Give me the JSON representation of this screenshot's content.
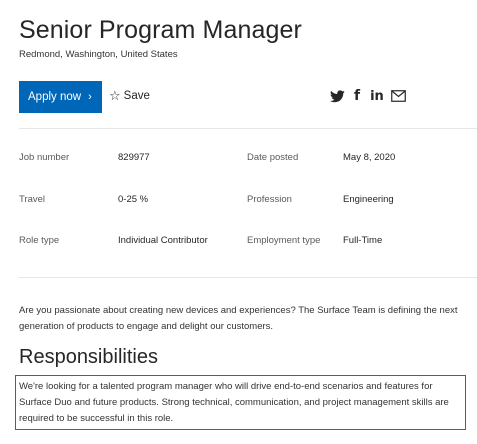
{
  "job": {
    "title": "Senior Program Manager",
    "location": "Redmond, Washington, United States"
  },
  "actions": {
    "apply_label": "Apply now",
    "apply_chevron": "›",
    "save_label": "Save",
    "save_icon_glyph": "☆"
  },
  "share": {
    "icons": [
      "twitter-icon",
      "facebook-icon",
      "linkedin-icon",
      "email-icon"
    ],
    "facebook_glyph": "f",
    "linkedin_glyph": "in"
  },
  "details": {
    "job_number_label": "Job number",
    "job_number_value": "829977",
    "date_posted_label": "Date posted",
    "date_posted_value": "May 8, 2020",
    "travel_label": "Travel",
    "travel_value": "0-25 %",
    "profession_label": "Profession",
    "profession_value": "Engineering",
    "role_type_label": "Role type",
    "role_type_value": "Individual Contributor",
    "employment_type_label": "Employment type",
    "employment_type_value": "Full-Time"
  },
  "description": {
    "intro": "Are you passionate about creating new devices and experiences? The Surface Team is defining the next generation of products to engage and delight our customers.",
    "responsibilities_heading": "Responsibilities",
    "responsibilities_text": "We're looking for a talented program manager who will drive end-to-end scenarios and features for Surface Duo and future products. Strong technical, communication, and project management skills are required to be successful in this role."
  },
  "colors": {
    "accent": "#0067b8",
    "highlight_border": "#d9262f",
    "divider": "#e6e6e6"
  }
}
